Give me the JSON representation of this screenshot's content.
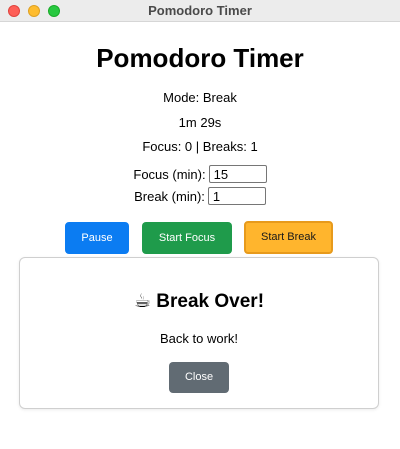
{
  "window": {
    "title": "Pomodoro Timer"
  },
  "app": {
    "heading": "Pomodoro Timer",
    "mode_text": "Mode: Break",
    "time_text": "1m 29s",
    "stats_text": "Focus: 0 | Breaks: 1"
  },
  "form": {
    "focus_label": "Focus (min):",
    "focus_value": "15",
    "break_label": "Break (min):",
    "break_value": "1"
  },
  "buttons": {
    "pause": "Pause",
    "start_focus": "Start Focus",
    "start_break": "Start Break"
  },
  "modal": {
    "icon": "☕",
    "title": "Break Over!",
    "message": "Back to work!",
    "close": "Close"
  },
  "colors": {
    "pause": "#0b7cf2",
    "start_focus": "#1f9b4b",
    "start_break": "#ffb52d",
    "close": "#616b73"
  }
}
